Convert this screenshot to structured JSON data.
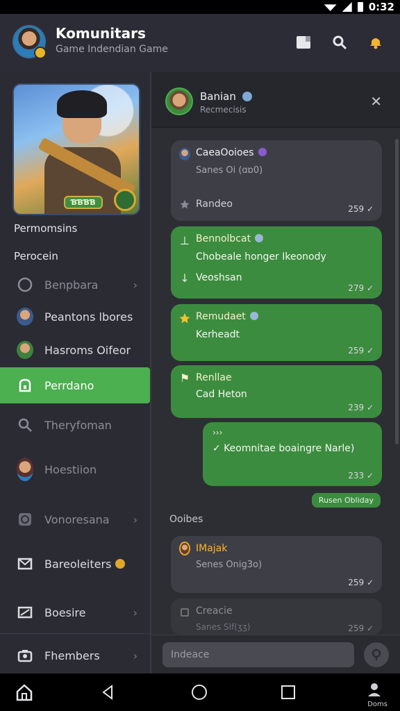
{
  "status_bar": {
    "time": "0:32"
  },
  "header": {
    "title": "Komunitars",
    "subtitle": "Game Indendian Game"
  },
  "sidebar": {
    "hero_badge": "ƁƁƁƁ",
    "heading_1": "Permomsins",
    "heading_2": "Perocein",
    "items": [
      {
        "label": "Benpbara",
        "chevron": true
      },
      {
        "label": "Peantons lbores",
        "chevron": false
      },
      {
        "label": "Hasroms Oifeor",
        "chevron": false
      },
      {
        "label": "Perrdano",
        "chevron": false,
        "active": true
      },
      {
        "label": "Theryfoman",
        "chevron": false
      },
      {
        "label": "Hoestiion",
        "chevron": false
      },
      {
        "label": "Vonoresana",
        "chevron": true
      },
      {
        "label": "Bareoleiters",
        "chevron": false
      },
      {
        "label": "Boesire",
        "chevron": true
      },
      {
        "label": "Fhembers",
        "chevron": true
      }
    ]
  },
  "chat": {
    "title": "Banian",
    "subtitle": "Recmecisis",
    "messages": [
      {
        "name": "CaeaOoioes",
        "line2": "Sanes Oi (ɑɒ0)",
        "line3": "Randeo",
        "time": "259"
      },
      {
        "name": "Bennolbcat",
        "line2": "Chobeale honger Ikeonody",
        "line3": "Veoshsan",
        "time": "279"
      },
      {
        "name": "Remudaet",
        "line2": "Kerheadt",
        "time": "259"
      },
      {
        "name": "Renllae",
        "line2": "Cad Heton",
        "time": "239"
      },
      {
        "name": "›››",
        "line2": "✓ Keomnitae boaingre Narle)",
        "time": "233"
      }
    ],
    "reply_chip": "Rusen Obliday",
    "section_label": "Ooibes",
    "messages_2": [
      {
        "name": "IMajak",
        "line2": "Senes Onig3o)",
        "time": "259"
      },
      {
        "name": "Creacie",
        "line2": "Sanes Slf(ʒʒ)",
        "time": "259"
      }
    ],
    "composer_placeholder": "Indeace"
  },
  "navbar": {
    "profile_label": "Doms"
  },
  "colors": {
    "accent": "#4caf50",
    "bubble_green": "#3c8c3f",
    "bubble_grey": "#3e3f46",
    "gold": "#e5b52a"
  }
}
